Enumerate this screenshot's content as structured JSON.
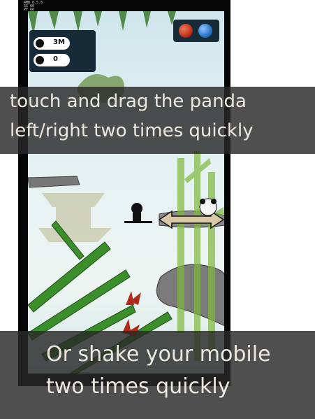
{
  "status_bar": {
    "text": "4MB 0.5.6\nSS 60\nPF 60"
  },
  "hud": {
    "distance": "3M",
    "score": "0"
  },
  "buttons": {
    "red_orb": "red-orb",
    "blue_orb": "blue-orb"
  },
  "instructions": {
    "top_line1": "touch and drag the panda",
    "top_line2": "left/right two times quickly",
    "bottom_line1": "Or shake your mobile",
    "bottom_line2": "two times quickly"
  },
  "colors": {
    "overlay": "#2b2b2b",
    "text": "#ece8df",
    "red_orb": "#c0311b",
    "blue_orb": "#2876c8",
    "bamboo": "#3a8f2a"
  }
}
